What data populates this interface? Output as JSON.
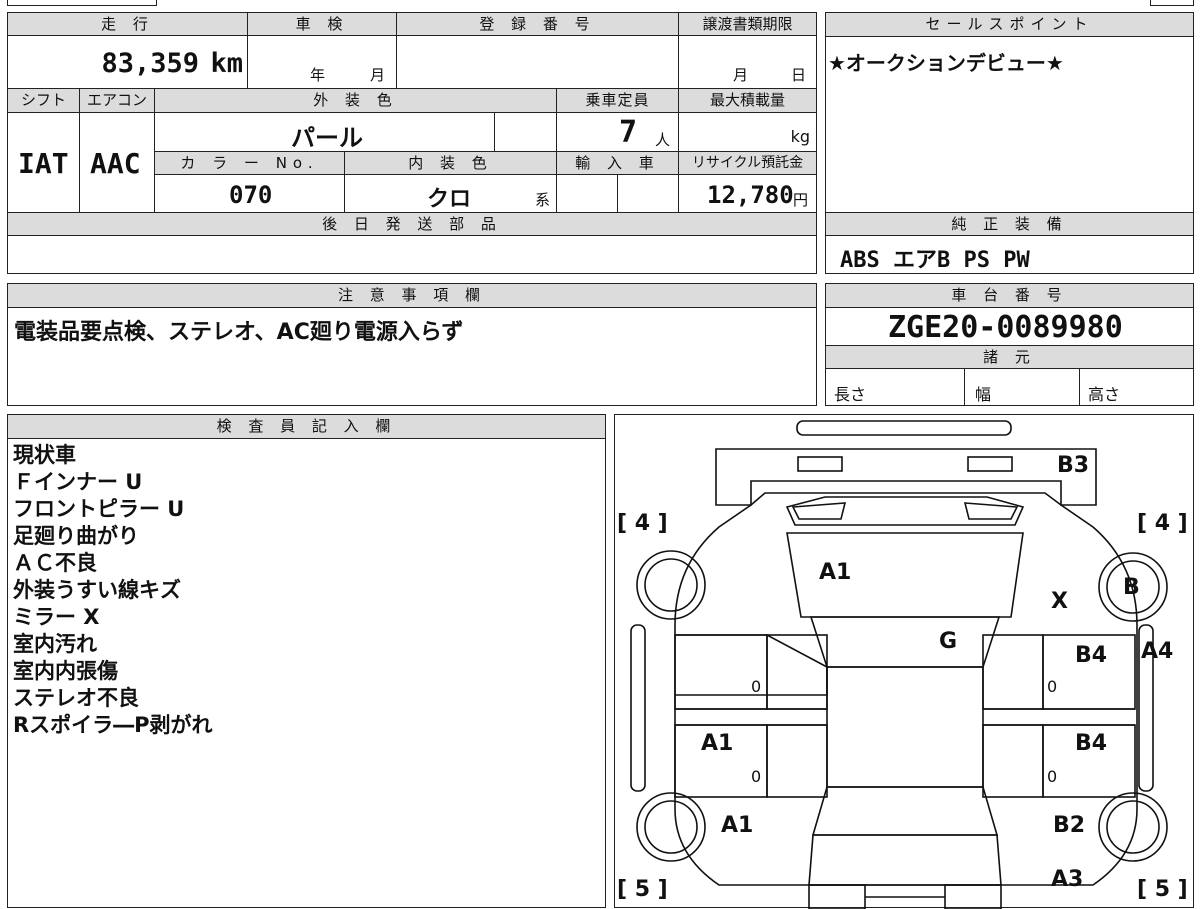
{
  "header": {
    "mileage_label": "走 行",
    "mileage_value": "83,359",
    "mileage_unit": "km",
    "shaken_label": "車 検",
    "shaken_year": "年",
    "shaken_month": "月",
    "registration_label": "登 録 番 号",
    "transfer_label": "譲渡書類期限",
    "transfer_month": "月",
    "transfer_day": "日"
  },
  "specs": {
    "shift_label": "シフト",
    "shift_value": "IAT",
    "ac_label": "エアコン",
    "ac_value": "AAC",
    "exterior_color_label": "外 装 色",
    "exterior_color_value": "パール",
    "capacity_label": "乗車定員",
    "capacity_value": "7",
    "capacity_unit": "人",
    "max_load_label": "最大積載量",
    "max_load_unit": "kg",
    "color_no_label": "カ ラ ー No.",
    "color_no_value": "070",
    "interior_color_label": "内 装 色",
    "interior_color_value": "クロ",
    "interior_color_suffix": "系",
    "import_label": "輸 入 車",
    "recycle_label": "リサイクル預託金",
    "recycle_value": "12,780",
    "recycle_unit": "円"
  },
  "later_parts": {
    "label": "後 日 発 送 部 品",
    "value": ""
  },
  "sales_point": {
    "label": "セールスポイント",
    "value": "★オークションデビュー★"
  },
  "genuine_equipment": {
    "label": "純 正 装 備",
    "value": "ABS エアB PS PW"
  },
  "notes": {
    "label": "注 意 事 項 欄",
    "value": "電装品要点検、ステレオ、AC廻り電源入らず"
  },
  "chassis": {
    "label": "車 台 番 号",
    "value": "ZGE20-0089980"
  },
  "dimensions": {
    "label": "諸 元",
    "length": "長さ",
    "width": "幅",
    "height": "高さ"
  },
  "inspector": {
    "label": "検 査 員 記 入 欄",
    "lines": [
      "現状車",
      "Ｆインナー U",
      "フロントピラー U",
      "足廻り曲がり",
      "ＡＣ不良",
      "外装うすい線キズ",
      "ミラー X",
      "室内汚れ",
      "室内内張傷",
      "ステレオ不良",
      "Rスポイラ―P剥がれ"
    ]
  },
  "diagram": {
    "marks": {
      "b3": "B3",
      "a1_hood": "A1",
      "x_mirror": "X",
      "b_wheel": "B",
      "g_windshield": "G",
      "b4_front_right": "B4",
      "a4_right": "A4",
      "a1_left_door": "A1",
      "b4_rear_right": "B4",
      "a1_left_rear": "A1",
      "b2_right_rear": "B2",
      "a3_right_rear": "A3"
    },
    "tire_left_front": "[ 4 ]",
    "tire_right_front": "[ 4 ]",
    "tire_left_rear": "[ 5 ]",
    "tire_right_rear": "[ 5 ]",
    "zero": "0"
  }
}
